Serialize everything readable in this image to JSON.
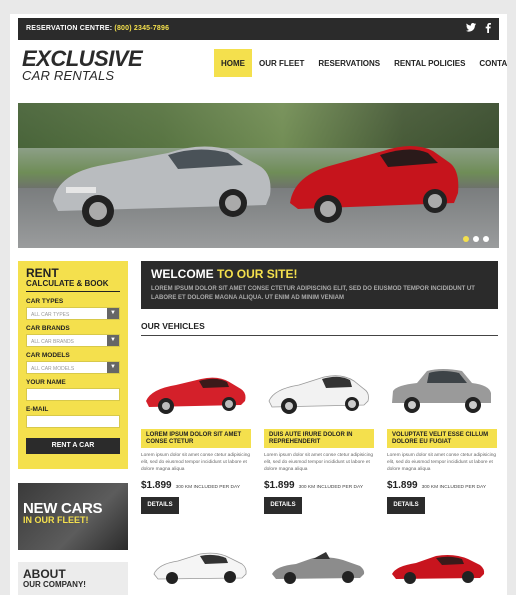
{
  "topbar": {
    "reservation_label": "RESERVATION CENTRE:",
    "phone": "(800) 2345-7896",
    "social": [
      "twitter-icon",
      "facebook-icon"
    ]
  },
  "logo": {
    "line1": "EXCLUSIVE",
    "line2": "CAR RENTALS"
  },
  "nav": {
    "items": [
      {
        "label": "HOME",
        "active": true
      },
      {
        "label": "OUR FLEET"
      },
      {
        "label": "RESERVATIONS"
      },
      {
        "label": "RENTAL POLICIES"
      },
      {
        "label": "CONTACTS"
      }
    ]
  },
  "slider": {
    "dots": 3,
    "active_dot": 0
  },
  "rent": {
    "title": "RENT",
    "subtitle": "CALCULATE & BOOK",
    "car_types_label": "CAR TYPES",
    "car_types_value": "ALL CAR TYPES",
    "car_brands_label": "CAR BRANDS",
    "car_brands_value": "ALL CAR BRANDS",
    "car_models_label": "CAR MODELS",
    "car_models_value": "ALL CAR MODELS",
    "name_label": "YOUR NAME",
    "email_label": "E-MAIL",
    "button": "RENT A CAR"
  },
  "promo": {
    "line1": "NEW CARS",
    "line2": "IN OUR FLEET!"
  },
  "about": {
    "line1": "ABOUT",
    "line2": "OUR COMPANY!"
  },
  "welcome": {
    "title_a": "WELCOME",
    "title_b": "TO OUR SITE!",
    "text": "LOREM IPSUM DOLOR SIT AMET CONSE CTETUR ADIPISCING ELIT, SED DO EIUSMOD TEMPOR INCIDIDUNT UT LABORE ET DOLORE MAGNA ALIQUA. UT ENIM AD MINIM VENIAM"
  },
  "vehicles": {
    "title": "OUR VEHICLES",
    "cards": [
      {
        "name": "LOREM IPSUM DOLOR SIT AMET CONSE CTETUR",
        "desc": "Lorem ipsum dolor sit amet conse ctetur adipisicing elit, sed do eiusmod tempor incididunt ut labore et dolore magna aliqua",
        "price": "$1.899",
        "included": "300 KM INCLUDED PER DAY",
        "button": "DETAILS",
        "color": "#d4202a"
      },
      {
        "name": "DUIS AUTE IRURE DOLOR IN REPREHENDERIT",
        "desc": "Lorem ipsum dolor sit amet conse ctetur adipisicing elit, sed do eiusmod tempor incididunt ut labore et dolore magna aliqua",
        "price": "$1.899",
        "included": "300 KM INCLUDED PER DAY",
        "button": "DETAILS",
        "color": "#f2f2f2"
      },
      {
        "name": "VOLUPTATE VELIT ESSE CILLUM DOLORE EU FUGIAT",
        "desc": "Lorem ipsum dolor sit amet conse ctetur adipisicing elit, sed do eiusmod tempor incididunt ut labore et dolore magna aliqua",
        "price": "$1.899",
        "included": "300 KM INCLUDED PER DAY",
        "button": "DETAILS",
        "color": "#9a9a9a"
      }
    ]
  },
  "colors": {
    "accent": "#f4e04d",
    "dark": "#2b2b2b"
  }
}
